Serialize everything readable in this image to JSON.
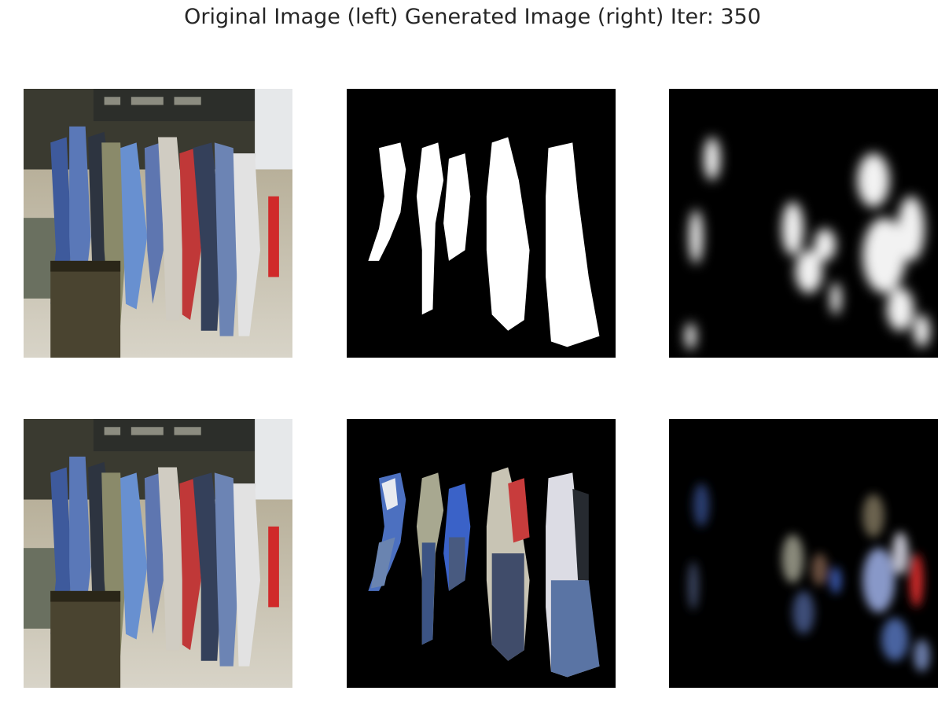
{
  "figure": {
    "title": "Original Image (left) Generated Image (right) Iter: 350"
  },
  "panels": [
    {
      "row": 1,
      "col": 1,
      "content": "original-photo"
    },
    {
      "row": 1,
      "col": 2,
      "content": "ground-truth-mask"
    },
    {
      "row": 1,
      "col": 3,
      "content": "generated-mask"
    },
    {
      "row": 2,
      "col": 1,
      "content": "original-photo"
    },
    {
      "row": 2,
      "col": 2,
      "content": "ground-truth-masked-photo"
    },
    {
      "row": 2,
      "col": 3,
      "content": "generated-masked-photo"
    }
  ],
  "colors": {
    "background": "#ffffff",
    "title_text": "#262626",
    "mask_fg": "#ffffff",
    "mask_bg": "#000000"
  }
}
